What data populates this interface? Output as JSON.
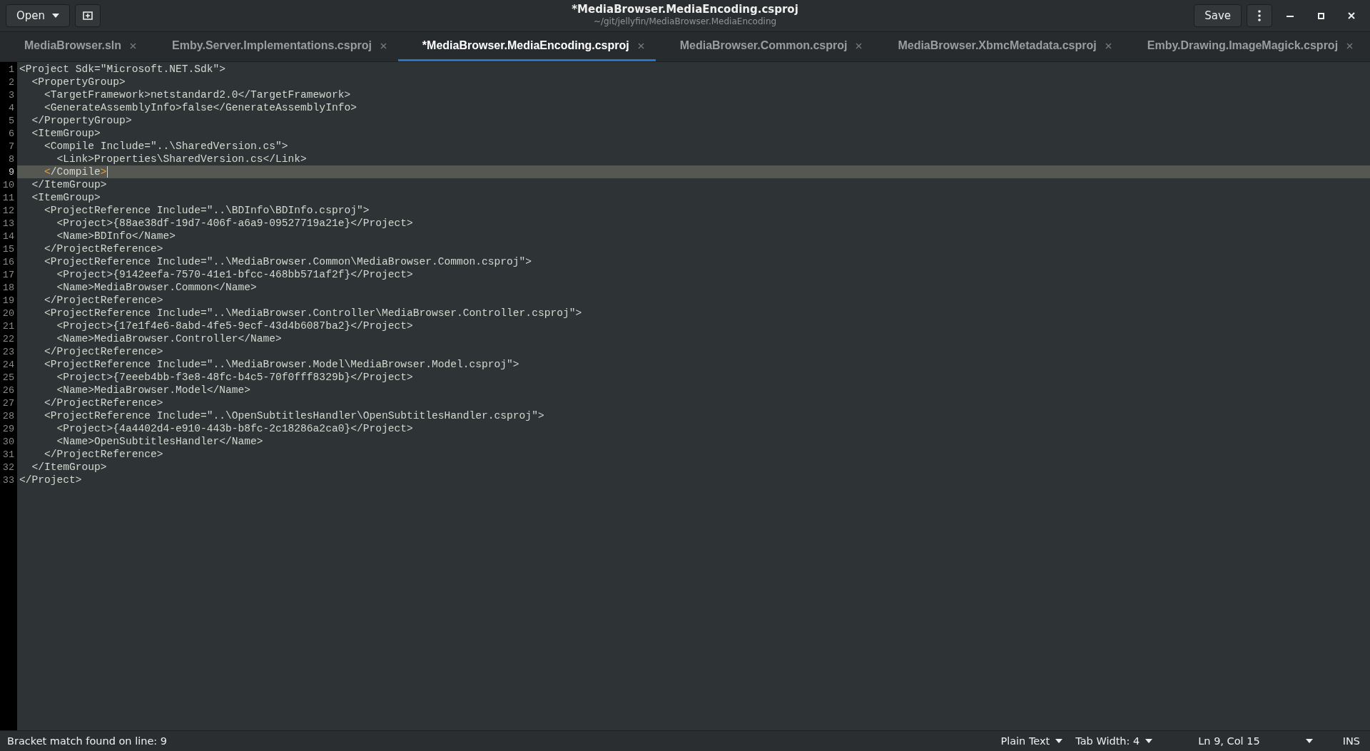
{
  "header": {
    "open_button": "Open",
    "title": "*MediaBrowser.MediaEncoding.csproj",
    "subtitle": "~/git/jellyfin/MediaBrowser.MediaEncoding",
    "save_button": "Save"
  },
  "tabs": [
    {
      "label": "MediaBrowser.sln",
      "selected": false
    },
    {
      "label": "Emby.Server.Implementations.csproj",
      "selected": false
    },
    {
      "label": "*MediaBrowser.MediaEncoding.csproj",
      "selected": true
    },
    {
      "label": "MediaBrowser.Common.csproj",
      "selected": false
    },
    {
      "label": "MediaBrowser.XbmcMetadata.csproj",
      "selected": false
    },
    {
      "label": "Emby.Drawing.ImageMagick.csproj",
      "selected": false
    }
  ],
  "editor": {
    "lines": [
      {
        "number": "1",
        "text": "<Project Sdk=\"Microsoft.NET.Sdk\">",
        "current": false
      },
      {
        "number": "2",
        "text": "  <PropertyGroup>",
        "current": false
      },
      {
        "number": "3",
        "text": "    <TargetFramework>netstandard2.0</TargetFramework>",
        "current": false
      },
      {
        "number": "4",
        "text": "    <GenerateAssemblyInfo>false</GenerateAssemblyInfo>",
        "current": false
      },
      {
        "number": "5",
        "text": "  </PropertyGroup>",
        "current": false
      },
      {
        "number": "6",
        "text": "  <ItemGroup>",
        "current": false
      },
      {
        "number": "7",
        "text": "    <Compile Include=\"..\\SharedVersion.cs\">",
        "current": false
      },
      {
        "number": "8",
        "text": "      <Link>Properties\\SharedVersion.cs</Link>",
        "current": false
      },
      {
        "number": "9",
        "text": "    </Compile>",
        "bracket_match": true,
        "current": true
      },
      {
        "number": "10",
        "text": "  </ItemGroup>",
        "current": false
      },
      {
        "number": "11",
        "text": "  <ItemGroup>",
        "current": false
      },
      {
        "number": "12",
        "text": "    <ProjectReference Include=\"..\\BDInfo\\BDInfo.csproj\">",
        "current": false
      },
      {
        "number": "13",
        "text": "      <Project>{88ae38df-19d7-406f-a6a9-09527719a21e}</Project>",
        "current": false
      },
      {
        "number": "14",
        "text": "      <Name>BDInfo</Name>",
        "current": false
      },
      {
        "number": "15",
        "text": "    </ProjectReference>",
        "current": false
      },
      {
        "number": "16",
        "text": "    <ProjectReference Include=\"..\\MediaBrowser.Common\\MediaBrowser.Common.csproj\">",
        "current": false
      },
      {
        "number": "17",
        "text": "      <Project>{9142eefa-7570-41e1-bfcc-468bb571af2f}</Project>",
        "current": false
      },
      {
        "number": "18",
        "text": "      <Name>MediaBrowser.Common</Name>",
        "current": false
      },
      {
        "number": "19",
        "text": "    </ProjectReference>",
        "current": false
      },
      {
        "number": "20",
        "text": "    <ProjectReference Include=\"..\\MediaBrowser.Controller\\MediaBrowser.Controller.csproj\">",
        "current": false
      },
      {
        "number": "21",
        "text": "      <Project>{17e1f4e6-8abd-4fe5-9ecf-43d4b6087ba2}</Project>",
        "current": false
      },
      {
        "number": "22",
        "text": "      <Name>MediaBrowser.Controller</Name>",
        "current": false
      },
      {
        "number": "23",
        "text": "    </ProjectReference>",
        "current": false
      },
      {
        "number": "24",
        "text": "    <ProjectReference Include=\"..\\MediaBrowser.Model\\MediaBrowser.Model.csproj\">",
        "current": false
      },
      {
        "number": "25",
        "text": "      <Project>{7eeeb4bb-f3e8-48fc-b4c5-70f0fff8329b}</Project>",
        "current": false
      },
      {
        "number": "26",
        "text": "      <Name>MediaBrowser.Model</Name>",
        "current": false
      },
      {
        "number": "27",
        "text": "    </ProjectReference>",
        "current": false
      },
      {
        "number": "28",
        "text": "    <ProjectReference Include=\"..\\OpenSubtitlesHandler\\OpenSubtitlesHandler.csproj\">",
        "current": false
      },
      {
        "number": "29",
        "text": "      <Project>{4a4402d4-e910-443b-b8fc-2c18286a2ca0}</Project>",
        "current": false
      },
      {
        "number": "30",
        "text": "      <Name>OpenSubtitlesHandler</Name>",
        "current": false
      },
      {
        "number": "31",
        "text": "    </ProjectReference>",
        "current": false
      },
      {
        "number": "32",
        "text": "  </ItemGroup>",
        "current": false
      },
      {
        "number": "33",
        "text": "</Project>",
        "current": false
      }
    ]
  },
  "status_bar": {
    "message": "Bracket match found on line: 9",
    "language": "Plain Text",
    "tab_width": "Tab Width: 4",
    "position": "Ln 9, Col 15",
    "mode": "INS"
  }
}
